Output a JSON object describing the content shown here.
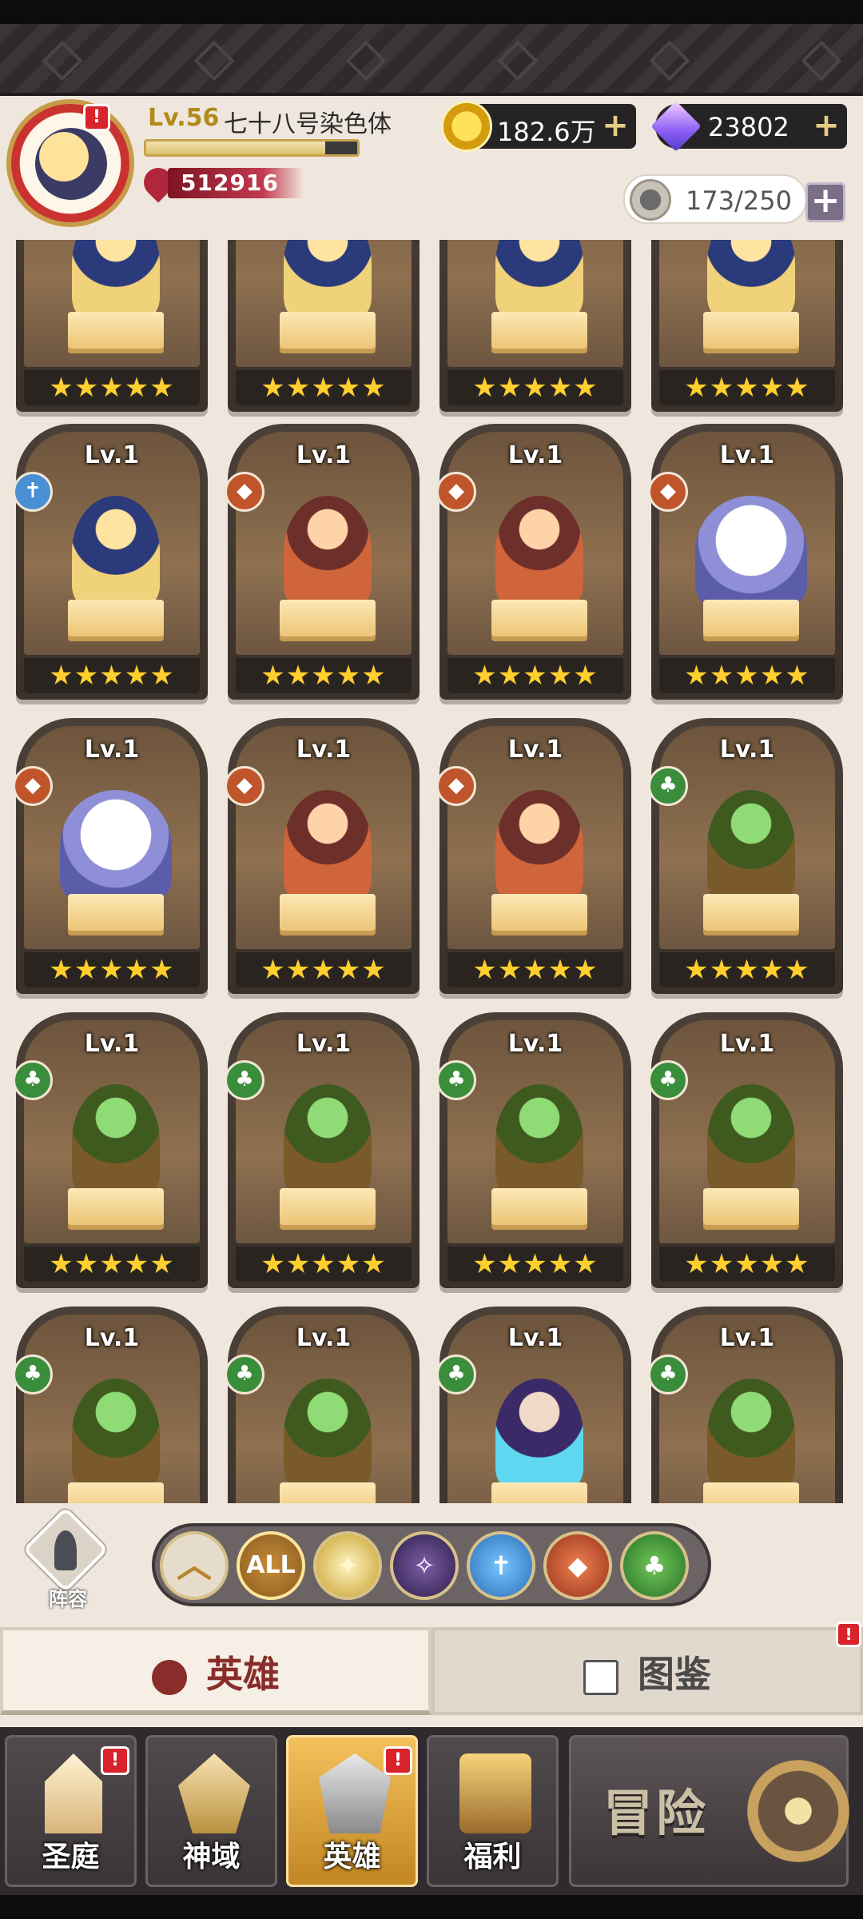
{
  "header": {
    "level": "Lv.56",
    "player_name": "七十八号染色体",
    "exp_fraction": 0.85,
    "power": "512916",
    "gold": "182.6万",
    "gems": "23802",
    "roster_capacity": "173/250",
    "plus_label": "+",
    "alert_label": "!"
  },
  "cards": {
    "stars": "★★★★★",
    "row1": {
      "c1": {
        "level": ""
      },
      "c2": {
        "level": ""
      },
      "c3": {
        "level": ""
      },
      "c4": {
        "level": ""
      }
    },
    "row2": {
      "c1": {
        "level": "Lv.1",
        "element": "holy"
      },
      "c2": {
        "level": "Lv.1",
        "element": "beast"
      },
      "c3": {
        "level": "Lv.1",
        "element": "beast"
      },
      "c4": {
        "level": "Lv.1",
        "element": "beast"
      }
    },
    "row3": {
      "c1": {
        "level": "Lv.1",
        "element": "beast"
      },
      "c2": {
        "level": "Lv.1",
        "element": "beast"
      },
      "c3": {
        "level": "Lv.1",
        "element": "beast"
      },
      "c4": {
        "level": "Lv.1",
        "element": "nature"
      }
    },
    "row4": {
      "c1": {
        "level": "Lv.1",
        "element": "nature"
      },
      "c2": {
        "level": "Lv.1",
        "element": "nature"
      },
      "c3": {
        "level": "Lv.1",
        "element": "nature"
      },
      "c4": {
        "level": "Lv.1",
        "element": "nature"
      }
    },
    "row5": {
      "c1": {
        "level": "Lv.1",
        "element": "nature"
      },
      "c2": {
        "level": "Lv.1",
        "element": "nature"
      },
      "c3": {
        "level": "Lv.1",
        "element": "nature"
      },
      "c4": {
        "level": "Lv.1",
        "element": "nature"
      }
    }
  },
  "lineup": {
    "label": "阵容"
  },
  "filters": {
    "all_label": "ALL",
    "items": [
      "sort-up",
      "all",
      "light",
      "dark",
      "holy",
      "beast",
      "nature"
    ]
  },
  "tabs": {
    "heroes": "英雄",
    "codex": "图鉴"
  },
  "nav": {
    "court": "圣庭",
    "domain": "神域",
    "heroes": "英雄",
    "welfare": "福利",
    "adventure": "冒险"
  },
  "colors": {
    "accent_gold": "#c79b47",
    "alert_red": "#d8232a",
    "star_yellow": "#ffcf2e",
    "tab_active_text": "#8a2d2a"
  }
}
